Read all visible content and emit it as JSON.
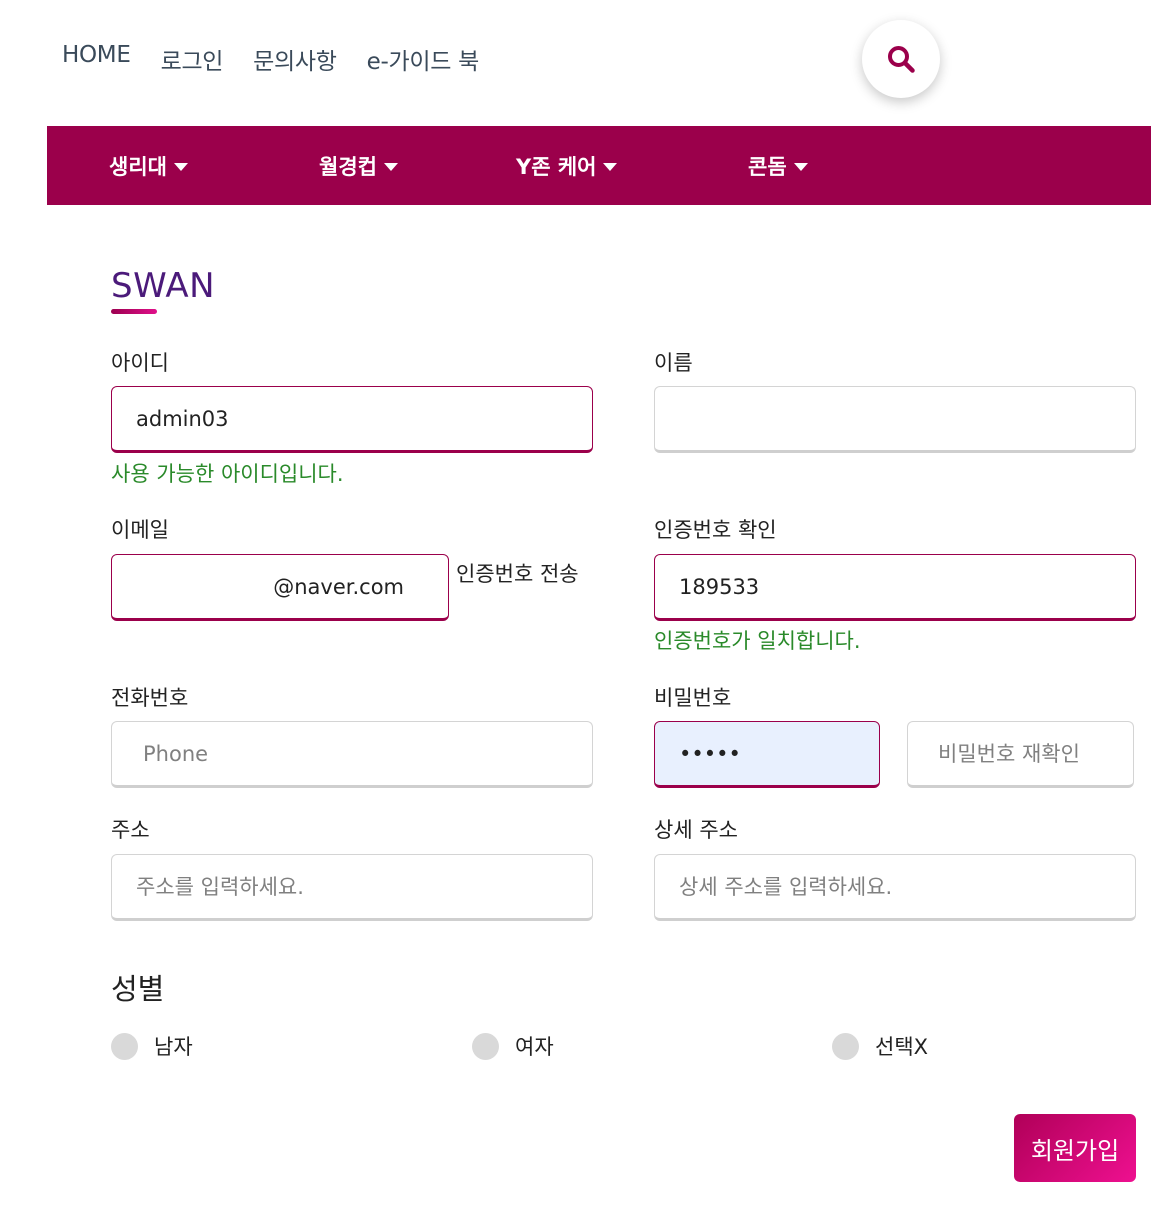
{
  "colors": {
    "brand": "#9b004b",
    "success": "#2a8a2a",
    "title": "#4b1a7a"
  },
  "topnav": {
    "items": [
      "HOME",
      "로그인",
      "문의사항",
      "e-가이드 북"
    ]
  },
  "search": {
    "icon": "search-icon"
  },
  "categories": [
    "생리대",
    "월경컵",
    "Y존 케어",
    "콘돔"
  ],
  "brand": {
    "title": "SWAN"
  },
  "form": {
    "userid": {
      "label": "아이디",
      "value": "admin03",
      "help": "사용 가능한 아이디입니다."
    },
    "name": {
      "label": "이름",
      "value": ""
    },
    "email": {
      "label": "이메일",
      "value": "@naver.com",
      "send_label": "인증번호 전송"
    },
    "verify": {
      "label": "인증번호 확인",
      "value": "189533",
      "help": "인증번호가 일치합니다."
    },
    "phone": {
      "label": "전화번호",
      "placeholder": "Phone"
    },
    "password": {
      "label": "비밀번호",
      "value": "•••••",
      "confirm_placeholder": "비밀번호 재확인"
    },
    "address": {
      "label": "주소",
      "placeholder": "주소를 입력하세요."
    },
    "address_detail": {
      "label": "상세 주소",
      "placeholder": "상세 주소를 입력하세요."
    },
    "gender": {
      "label": "성별",
      "options": [
        "남자",
        "여자",
        "선택X"
      ]
    },
    "submit_label": "회원가입"
  }
}
